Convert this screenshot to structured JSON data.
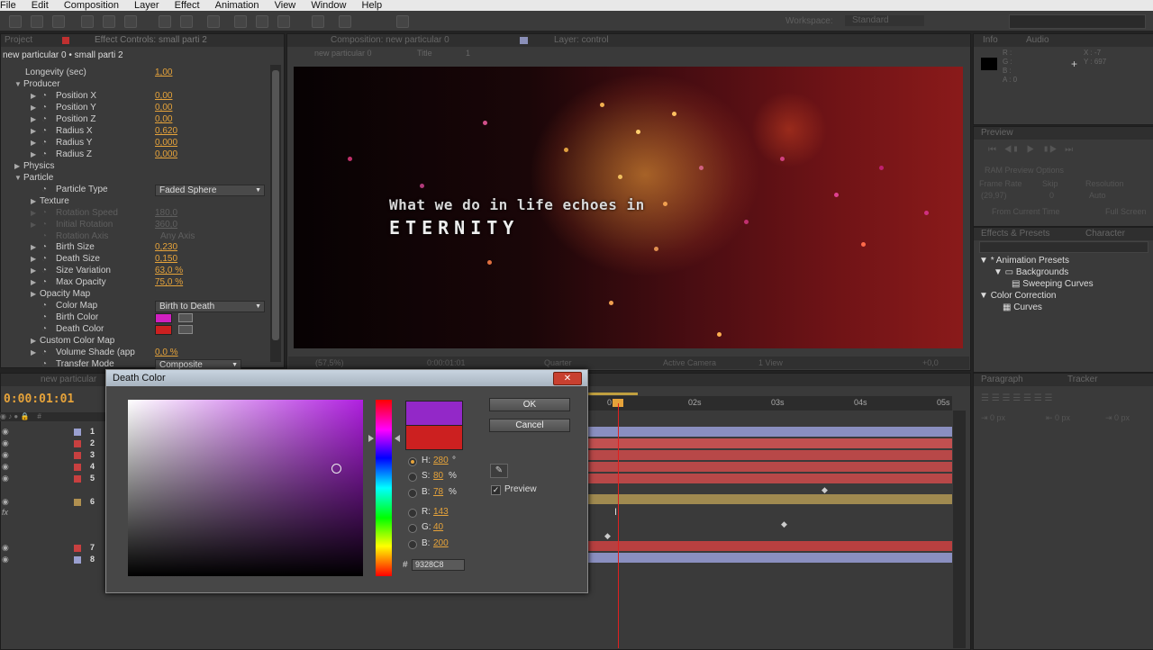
{
  "menu": [
    "File",
    "Edit",
    "Composition",
    "Layer",
    "Effect",
    "Animation",
    "View",
    "Window",
    "Help"
  ],
  "workspace": {
    "label": "Workspace:",
    "value": "Standard"
  },
  "effect_controls": {
    "tab_project": "Project",
    "tab_title": "Effect Controls: small parti 2",
    "breadcrumb": "new particular 0 • small parti 2",
    "rows": [
      {
        "label": "Longevity (sec)",
        "value": "1,00"
      },
      {
        "label": "Producer"
      },
      {
        "label": "Position X",
        "value": "0,00"
      },
      {
        "label": "Position Y",
        "value": "0,00"
      },
      {
        "label": "Position Z",
        "value": "0,00"
      },
      {
        "label": "Radius X",
        "value": "0,620"
      },
      {
        "label": "Radius Y",
        "value": "0,000"
      },
      {
        "label": "Radius Z",
        "value": "0,000"
      },
      {
        "label": "Physics"
      },
      {
        "label": "Particle"
      },
      {
        "label": "Particle Type",
        "value": "Faded Sphere"
      },
      {
        "label": "Texture"
      },
      {
        "label": "Rotation Speed",
        "value": "180,0"
      },
      {
        "label": "Initial Rotation",
        "value": "360,0"
      },
      {
        "label": "Rotation Axis",
        "value": "Any Axis"
      },
      {
        "label": "Birth Size",
        "value": "0,230"
      },
      {
        "label": "Death Size",
        "value": "0,150"
      },
      {
        "label": "Size Variation",
        "value": "63,0 %"
      },
      {
        "label": "Max Opacity",
        "value": "75,0 %"
      },
      {
        "label": "Opacity Map"
      },
      {
        "label": "Color Map",
        "value": "Birth to Death"
      },
      {
        "label": "Birth Color",
        "color": "#d020c0"
      },
      {
        "label": "Death Color",
        "color": "#cc2020"
      },
      {
        "label": "Custom Color Map"
      },
      {
        "label": "Volume Shade (app",
        "value": "0,0 %"
      },
      {
        "label": "Transfer Mode",
        "value": "Composite"
      }
    ]
  },
  "composition": {
    "tab_title": "Composition: new particular 0",
    "tab_layer": "Layer: control",
    "crumbs": [
      "new particular 0",
      "Title"
    ],
    "crumb_count": "1",
    "line1": "What we do in life echoes in",
    "line2": "ETERNITY",
    "zoom": "(57,5%)",
    "timecode": "0:00:01:01",
    "resolution": "Quarter",
    "camera": "Active Camera",
    "views": "1 View",
    "exposure": "+0,0"
  },
  "info": {
    "tab_info": "Info",
    "tab_audio": "Audio",
    "r": "R :",
    "g": "G :",
    "b": "B :",
    "a": "A : 0",
    "x": "X : -7",
    "y": "Y : 697"
  },
  "preview": {
    "tab": "Preview",
    "ram_options": "RAM Preview Options",
    "frame_rate": "Frame Rate",
    "skip": "Skip",
    "resolution": "Resolution",
    "fps": "(29,97)",
    "skip_val": "0",
    "res_val": "Auto",
    "from_current": "From Current Time",
    "full_screen": "Full Screen"
  },
  "effects_presets": {
    "tab": "Effects & Presets",
    "tab_char": "Character",
    "items": [
      {
        "label": "* Animation Presets",
        "level": 0
      },
      {
        "label": "Backgrounds",
        "level": 1
      },
      {
        "label": "Sweeping Curves",
        "level": 2
      },
      {
        "label": "Color Correction",
        "level": 0
      },
      {
        "label": "Curves",
        "level": 1
      }
    ]
  },
  "paragraph": {
    "tab": "Paragraph",
    "tab_tracker": "Tracker",
    "px1": "0 px",
    "px2": "0 px",
    "px3": "0 px"
  },
  "timeline": {
    "tab": "new particular",
    "timecode": "0:00:01:01",
    "ruler": [
      "0",
      "02s",
      "03s",
      "04s",
      "05s"
    ],
    "layers": [
      "1",
      "2",
      "3",
      "4",
      "5",
      "6",
      "7",
      "8"
    ],
    "layer_colors": [
      "#9aa0d0",
      "#c84040",
      "#c84040",
      "#c84040",
      "#c84040",
      "#b09050",
      "#c84040",
      "#9aa0d0"
    ],
    "fx_label": "fx"
  },
  "dialog": {
    "title": "Death Color",
    "close": "✕",
    "ok": "OK",
    "cancel": "Cancel",
    "h_label": "H:",
    "h_value": "280",
    "h_unit": "°",
    "s_label": "S:",
    "s_value": "80",
    "s_unit": "%",
    "b_label": "B:",
    "b_value": "78",
    "b_unit": "%",
    "r_label": "R:",
    "r_value": "143",
    "g_label": "G:",
    "g_value": "40",
    "bl_label": "B:",
    "bl_value": "200",
    "hex_hash": "#",
    "hex": "9328C8",
    "preview_label": "Preview",
    "preview_checked": "✓",
    "new_color": "#9328c8",
    "old_color": "#cc2020"
  }
}
